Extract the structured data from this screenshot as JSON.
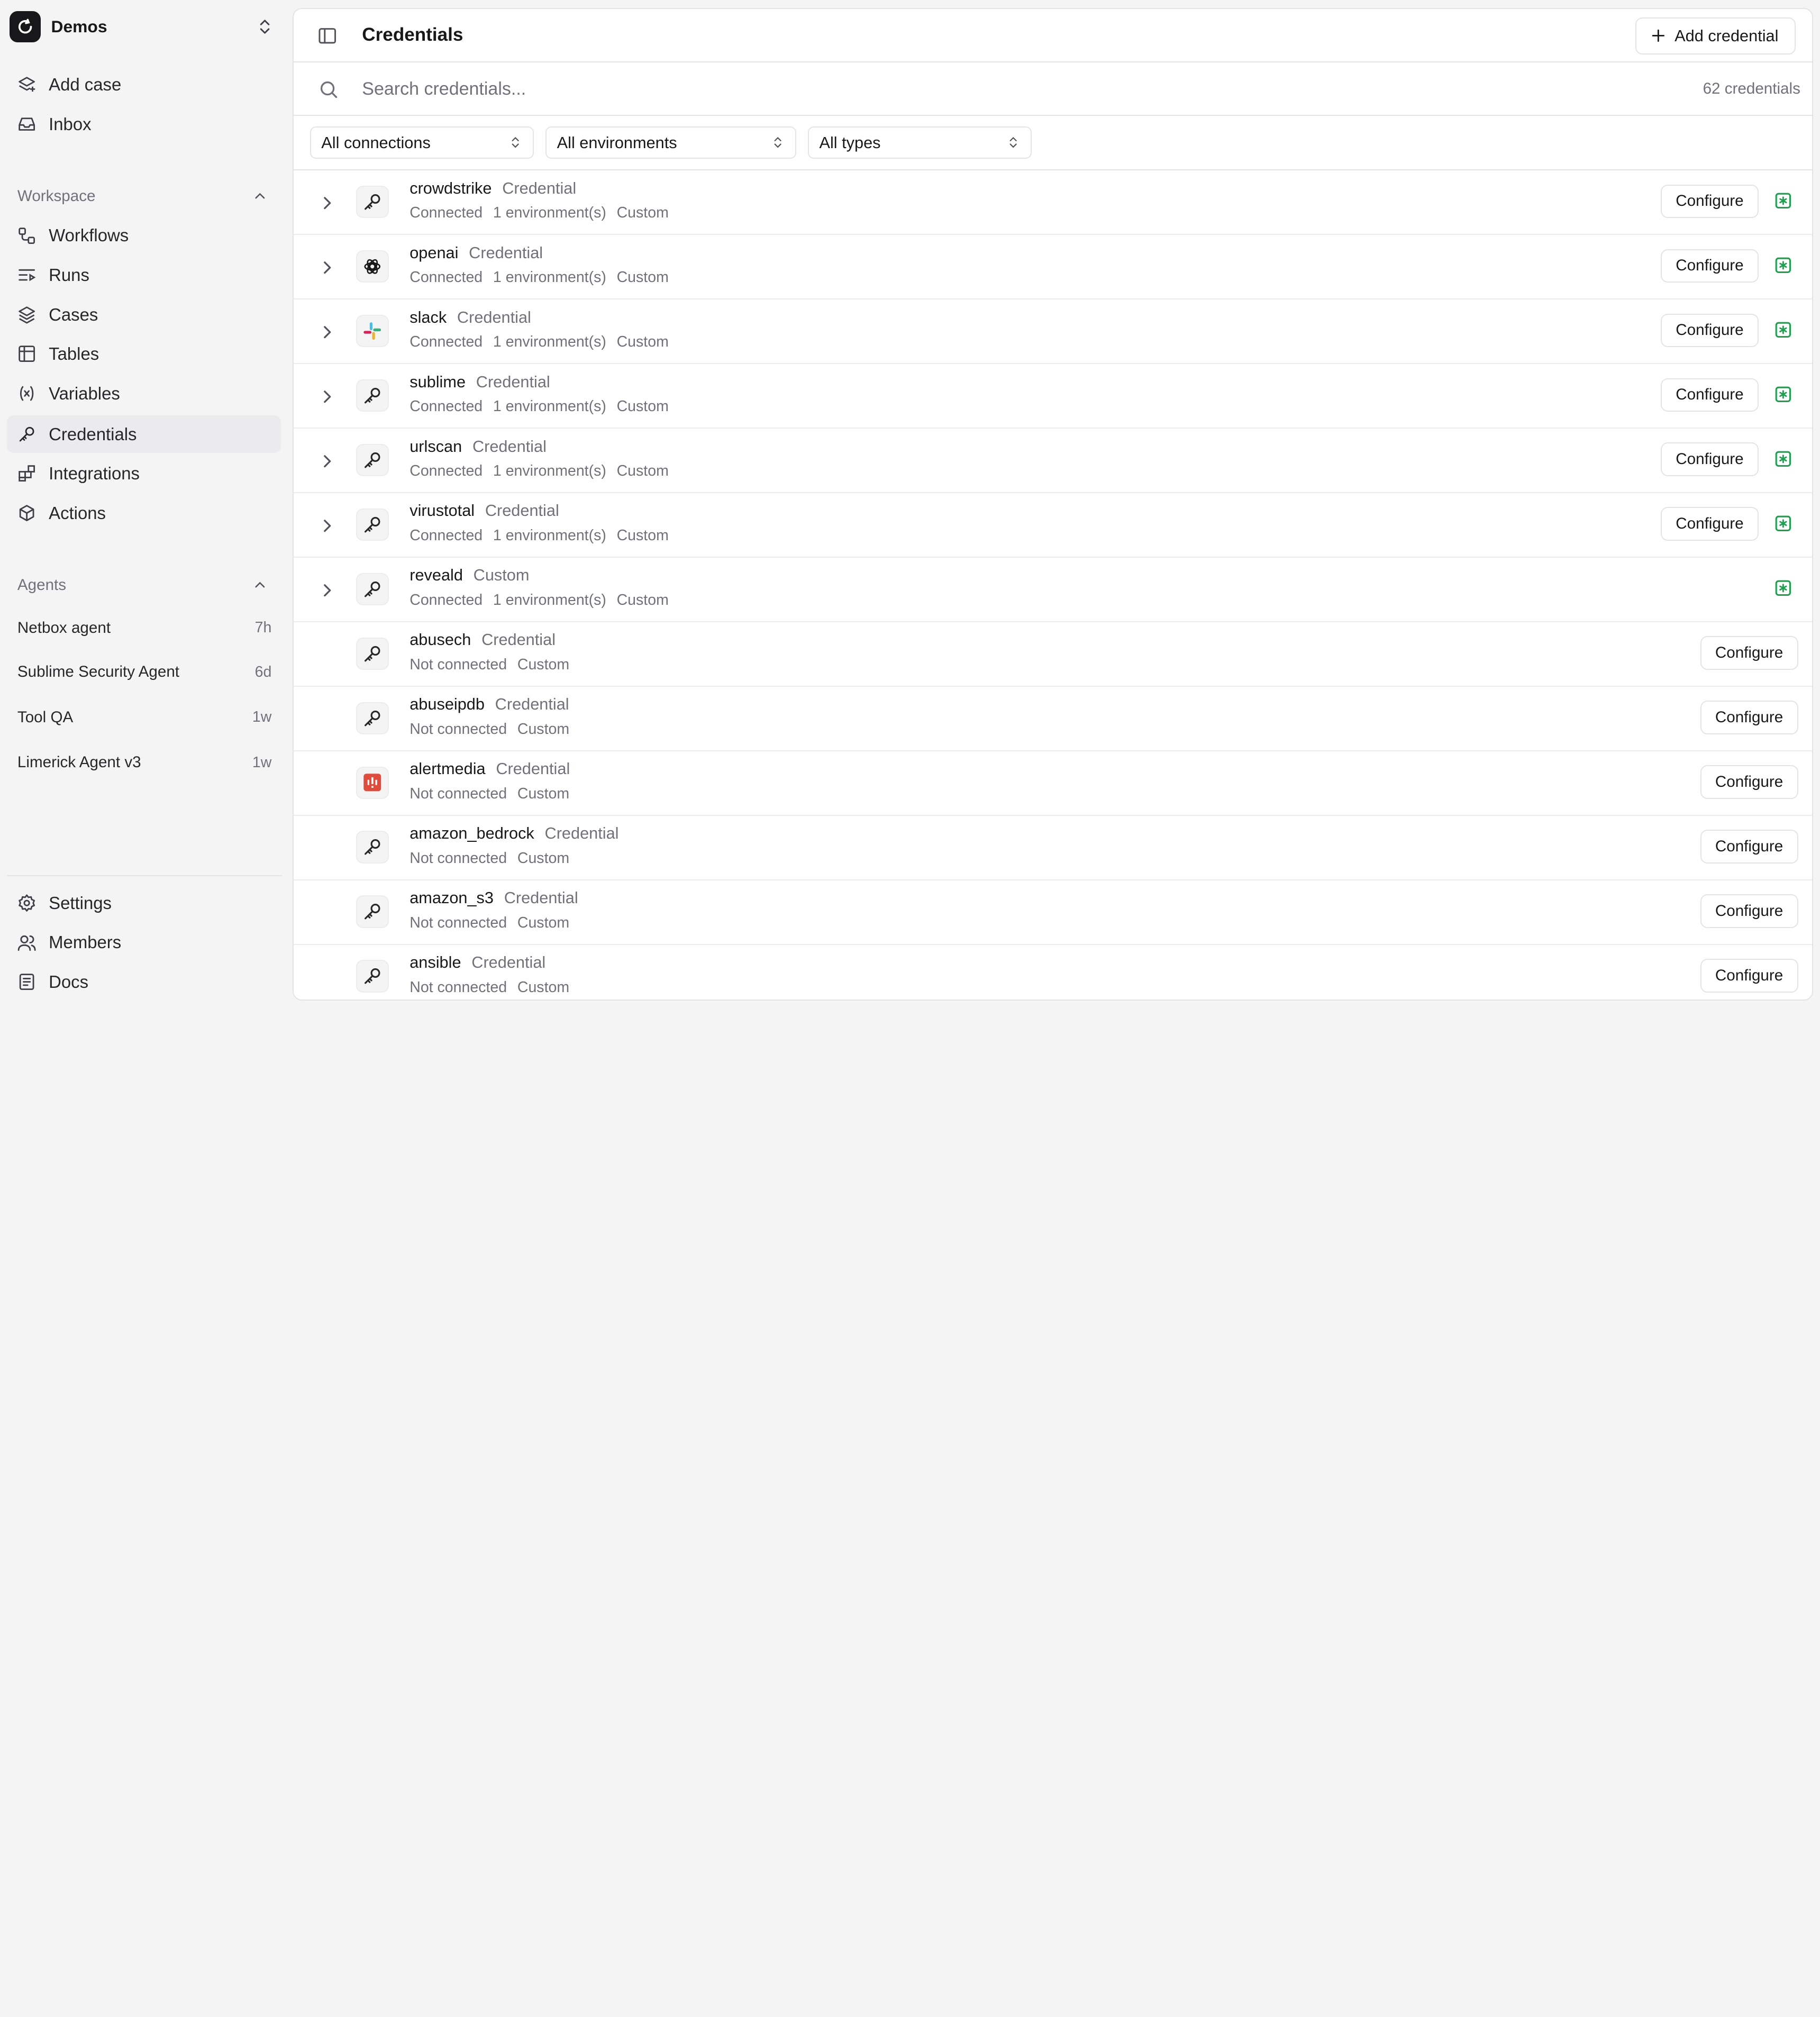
{
  "workspace": {
    "name": "Demos"
  },
  "nav_top": [
    {
      "label": "Add case",
      "icon": "layers-plus-icon"
    },
    {
      "label": "Inbox",
      "icon": "inbox-icon"
    }
  ],
  "workspace_section": {
    "title": "Workspace",
    "items": [
      {
        "label": "Workflows",
        "icon": "workflow-icon"
      },
      {
        "label": "Runs",
        "icon": "runs-icon"
      },
      {
        "label": "Cases",
        "icon": "layers-icon"
      },
      {
        "label": "Tables",
        "icon": "table-icon"
      },
      {
        "label": "Variables",
        "icon": "variable-icon"
      },
      {
        "label": "Credentials",
        "icon": "key-icon",
        "active": true
      },
      {
        "label": "Integrations",
        "icon": "blocks-icon"
      },
      {
        "label": "Actions",
        "icon": "box-icon"
      }
    ]
  },
  "agents_section": {
    "title": "Agents",
    "items": [
      {
        "name": "Netbox agent",
        "age": "7h"
      },
      {
        "name": "Sublime Security Agent",
        "age": "6d"
      },
      {
        "name": "Tool QA",
        "age": "1w"
      },
      {
        "name": "Limerick Agent v3",
        "age": "1w"
      }
    ]
  },
  "nav_bottom": [
    {
      "label": "Settings",
      "icon": "gear-icon"
    },
    {
      "label": "Members",
      "icon": "users-icon"
    },
    {
      "label": "Docs",
      "icon": "book-icon"
    }
  ],
  "header": {
    "title": "Credentials",
    "add_button": "Add credential"
  },
  "search": {
    "placeholder": "Search credentials...",
    "count": "62 credentials"
  },
  "filters": {
    "connections": "All connections",
    "environments": "All environments",
    "types": "All types"
  },
  "colors": {
    "connected_green": "#16a34a",
    "accent_dark": "#18181b"
  },
  "credentials": [
    {
      "name": "crowdstrike",
      "kind": "Credential",
      "status": "Connected",
      "environments": "1 environment(s)",
      "type": "Custom",
      "configure": "Configure",
      "connected": true,
      "expandable": true,
      "logo": "key-icon"
    },
    {
      "name": "openai",
      "kind": "Credential",
      "status": "Connected",
      "environments": "1 environment(s)",
      "type": "Custom",
      "configure": "Configure",
      "connected": true,
      "expandable": true,
      "logo": "openai-icon"
    },
    {
      "name": "slack",
      "kind": "Credential",
      "status": "Connected",
      "environments": "1 environment(s)",
      "type": "Custom",
      "configure": "Configure",
      "connected": true,
      "expandable": true,
      "logo": "slack-icon"
    },
    {
      "name": "sublime",
      "kind": "Credential",
      "status": "Connected",
      "environments": "1 environment(s)",
      "type": "Custom",
      "configure": "Configure",
      "connected": true,
      "expandable": true,
      "logo": "key-icon"
    },
    {
      "name": "urlscan",
      "kind": "Credential",
      "status": "Connected",
      "environments": "1 environment(s)",
      "type": "Custom",
      "configure": "Configure",
      "connected": true,
      "expandable": true,
      "logo": "key-icon"
    },
    {
      "name": "virustotal",
      "kind": "Credential",
      "status": "Connected",
      "environments": "1 environment(s)",
      "type": "Custom",
      "configure": "Configure",
      "connected": true,
      "expandable": true,
      "logo": "key-icon"
    },
    {
      "name": "reveald",
      "kind": "Custom",
      "status": "Connected",
      "environments": "1 environment(s)",
      "type": "Custom",
      "configure": "",
      "connected": true,
      "expandable": true,
      "logo": "key-icon"
    },
    {
      "name": "abusech",
      "kind": "Credential",
      "status": "Not connected",
      "environments": "",
      "type": "Custom",
      "configure": "Configure",
      "connected": false,
      "expandable": false,
      "logo": "key-icon"
    },
    {
      "name": "abuseipdb",
      "kind": "Credential",
      "status": "Not connected",
      "environments": "",
      "type": "Custom",
      "configure": "Configure",
      "connected": false,
      "expandable": false,
      "logo": "key-icon"
    },
    {
      "name": "alertmedia",
      "kind": "Credential",
      "status": "Not connected",
      "environments": "",
      "type": "Custom",
      "configure": "Configure",
      "connected": false,
      "expandable": false,
      "logo": "alertmedia-icon"
    },
    {
      "name": "amazon_bedrock",
      "kind": "Credential",
      "status": "Not connected",
      "environments": "",
      "type": "Custom",
      "configure": "Configure",
      "connected": false,
      "expandable": false,
      "logo": "key-icon"
    },
    {
      "name": "amazon_s3",
      "kind": "Credential",
      "status": "Not connected",
      "environments": "",
      "type": "Custom",
      "configure": "Configure",
      "connected": false,
      "expandable": false,
      "logo": "key-icon"
    },
    {
      "name": "ansible",
      "kind": "Credential",
      "status": "Not connected",
      "environments": "",
      "type": "Custom",
      "configure": "Configure",
      "connected": false,
      "expandable": false,
      "logo": "key-icon"
    }
  ]
}
